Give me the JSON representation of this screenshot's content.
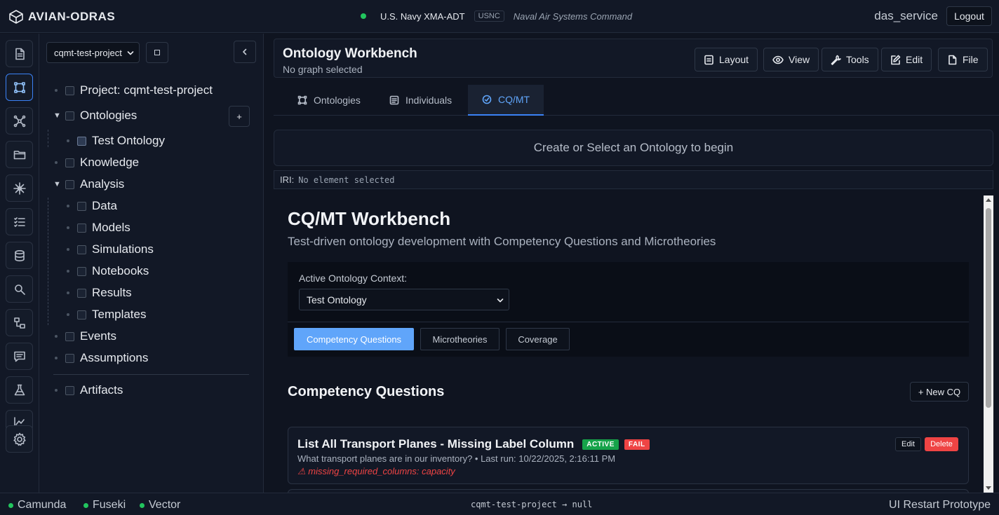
{
  "app": {
    "brand": "AVIAN-ODRAS",
    "org_name": "U.S. Navy XMA-ADT",
    "org_badge": "USNC",
    "org_command": "Naval Air Systems Command",
    "user": "das_service",
    "logout_label": "Logout"
  },
  "rail": {
    "items": [
      {
        "icon": "document-icon",
        "active": false
      },
      {
        "icon": "graph-nodes-icon",
        "active": true
      },
      {
        "icon": "network-icon",
        "active": false
      },
      {
        "icon": "folder-icon",
        "active": false
      },
      {
        "icon": "sparkle-icon",
        "active": false
      },
      {
        "icon": "checklist-icon",
        "active": false
      },
      {
        "icon": "database-icon",
        "active": false
      },
      {
        "icon": "search-icon",
        "active": false
      },
      {
        "icon": "hierarchy-icon",
        "active": false
      },
      {
        "icon": "chat-icon",
        "active": false
      },
      {
        "icon": "flask-icon",
        "active": false
      },
      {
        "icon": "chart-icon",
        "active": false
      },
      {
        "icon": "gear-icon",
        "active": false
      }
    ]
  },
  "project_panel": {
    "project_select": "cqmt-test-project",
    "add_label": "+",
    "tree": {
      "project": "Project: cqmt-test-project",
      "ontologies": "Ontologies",
      "test_ontology": "Test Ontology",
      "knowledge": "Knowledge",
      "analysis": "Analysis",
      "analysis_children": [
        "Data",
        "Models",
        "Simulations",
        "Notebooks",
        "Results",
        "Templates"
      ],
      "events": "Events",
      "assumptions": "Assumptions",
      "artifacts": "Artifacts"
    }
  },
  "workbench": {
    "title": "Ontology Workbench",
    "subtitle": "No graph selected",
    "tools": [
      "Layout",
      "View",
      "Tools",
      "Edit",
      "File"
    ],
    "tabs": [
      {
        "label": "Ontologies",
        "active": false
      },
      {
        "label": "Individuals",
        "active": false
      },
      {
        "label": "CQ/MT",
        "active": true
      }
    ],
    "canvas_message": "Create or Select an Ontology to begin",
    "iri_label": "IRI:",
    "iri_value": "No element selected"
  },
  "cqmt": {
    "title": "CQ/MT Workbench",
    "description": "Test-driven ontology development with Competency Questions and Microtheories",
    "context_label": "Active Ontology Context:",
    "context_value": "Test Ontology",
    "sub_tabs": [
      {
        "label": "Competency Questions",
        "active": true
      },
      {
        "label": "Microtheories",
        "active": false
      },
      {
        "label": "Coverage",
        "active": false
      }
    ],
    "section_title": "Competency Questions",
    "new_cq_label": "+ New CQ",
    "questions": [
      {
        "name": "List All Transport Planes - Missing Label Column",
        "status": "ACTIVE",
        "result": "FAIL",
        "meta": "What transport planes are in our inventory? • Last run: 10/22/2025, 2:16:11 PM",
        "error": "⚠ missing_required_columns: capacity",
        "edit_label": "Edit",
        "delete_label": "Delete"
      }
    ]
  },
  "statusbar": {
    "services": [
      "Camunda",
      "Fuseki",
      "Vector"
    ],
    "path": "cqmt-test-project → null",
    "prototype": "UI Restart Prototype"
  },
  "colors": {
    "accent": "#3b82f6",
    "active_tab_text": "#60a5fa",
    "success": "#22c55e",
    "danger": "#ef4444",
    "background": "#0f1420"
  }
}
